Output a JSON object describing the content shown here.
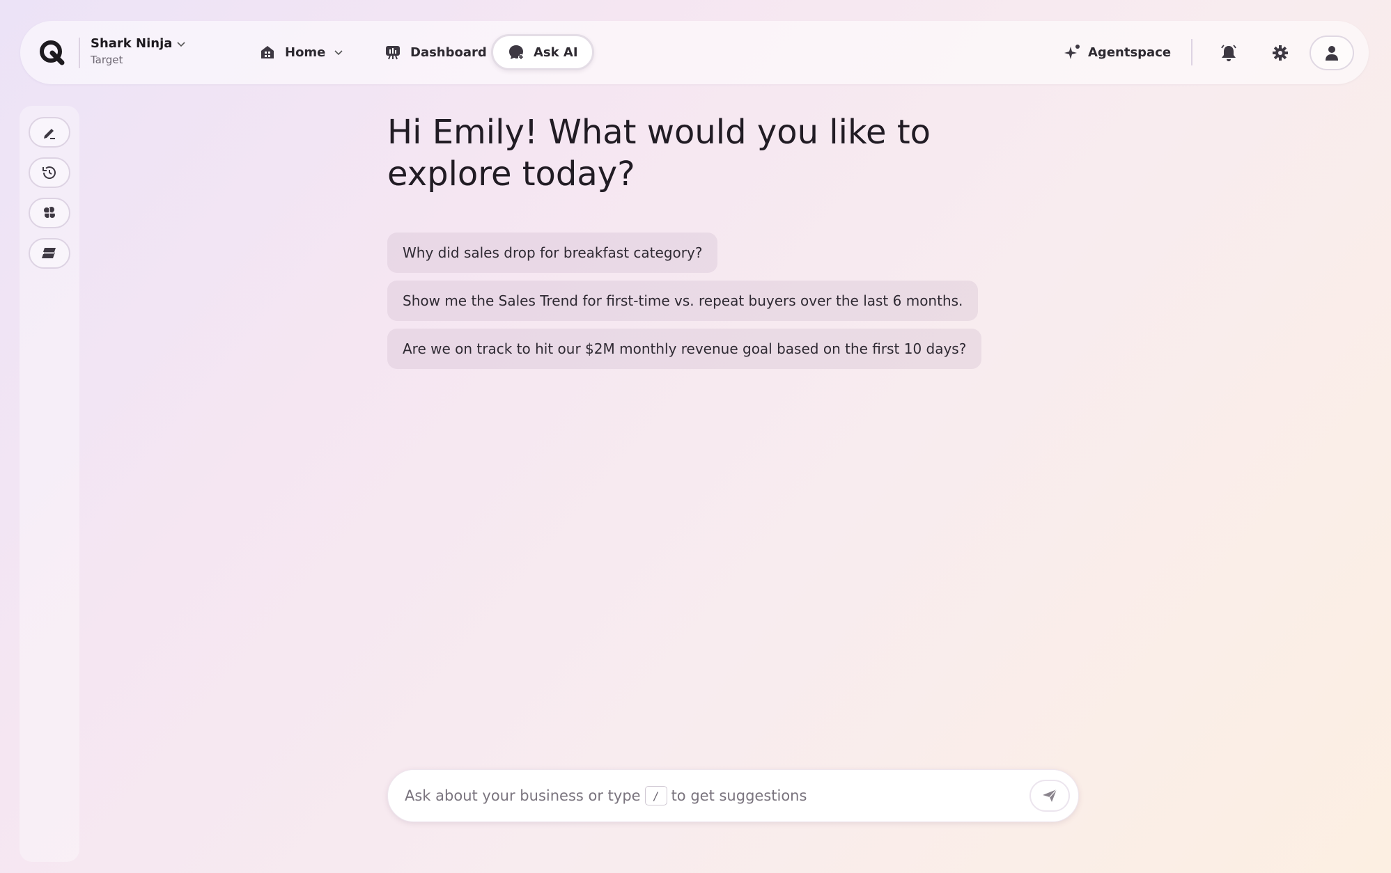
{
  "brand": {
    "name": "Shark Ninja",
    "subtitle": "Target"
  },
  "nav": {
    "home": "Home",
    "dashboard": "Dashboard",
    "ask_ai": "Ask AI",
    "active": "Ask AI"
  },
  "header_right": {
    "agentspace": "Agentspace"
  },
  "sidebar": {
    "items": [
      {
        "icon": "pencil-icon"
      },
      {
        "icon": "history-icon"
      },
      {
        "icon": "brain-icon"
      },
      {
        "icon": "layers-icon"
      }
    ]
  },
  "main": {
    "greeting": "Hi Emily! What would you like to explore today?",
    "suggestions": [
      "Why did sales drop for breakfast category?",
      "Show me the Sales Trend for first-time vs. repeat buyers over the last 6 months.",
      "Are we on track to hit our $2M monthly revenue goal based on the first 10 days?"
    ]
  },
  "chat": {
    "placeholder_before": "Ask about your business or type",
    "placeholder_key": "/",
    "placeholder_after": "to get suggestions"
  },
  "colors": {
    "text": "#1d1a1f",
    "active_tab_bg": "#ffffff",
    "suggestion_bg": "#e9dbe6"
  }
}
